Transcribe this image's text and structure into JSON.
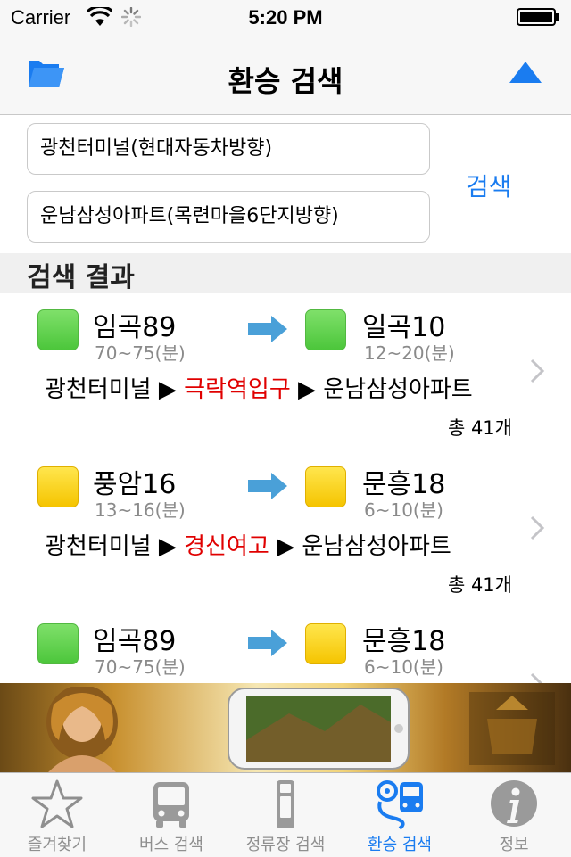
{
  "status_bar": {
    "carrier": "Carrier",
    "time": "5:20 PM"
  },
  "navbar": {
    "title": "환승 검색"
  },
  "search": {
    "from": "광천터미널(현대자동차방향)",
    "to": "운남삼성아파트(목련마을6단지방향)",
    "button_label": "검색"
  },
  "section_header": "검색 결과",
  "results": [
    {
      "first_bus": {
        "name": "임곡89",
        "time": "70~75(분)",
        "color": "#5dcf4a"
      },
      "second_bus": {
        "name": "일곡10",
        "time": "12~20(분)",
        "color": "#5dcf4a"
      },
      "route": {
        "start": "광천터미널",
        "transfer": "극락역입구",
        "end": "운남삼성아파트"
      },
      "count": "총 41개"
    },
    {
      "first_bus": {
        "name": "풍암16",
        "time": "13~16(분)",
        "color": "#f9d20f"
      },
      "second_bus": {
        "name": "문흥18",
        "time": "6~10(분)",
        "color": "#f9d20f"
      },
      "route": {
        "start": "광천터미널",
        "transfer": "경신여고",
        "end": "운남삼성아파트"
      },
      "count": "총 41개"
    },
    {
      "first_bus": {
        "name": "임곡89",
        "time": "70~75(분)",
        "color": "#5dcf4a"
      },
      "second_bus": {
        "name": "문흥18",
        "time": "6~10(분)",
        "color": "#f9d20f"
      }
    }
  ],
  "tabs": [
    {
      "label": "즐겨찾기",
      "icon": "star-icon",
      "active": false
    },
    {
      "label": "버스 검색",
      "icon": "bus-icon",
      "active": false
    },
    {
      "label": "정류장 검색",
      "icon": "bus-stop-icon",
      "active": false
    },
    {
      "label": "환승 검색",
      "icon": "transfer-icon",
      "active": true
    },
    {
      "label": "정보",
      "icon": "info-icon",
      "active": false
    }
  ],
  "colors": {
    "accent": "#1a7cf0",
    "transfer_stop": "#e00000"
  }
}
